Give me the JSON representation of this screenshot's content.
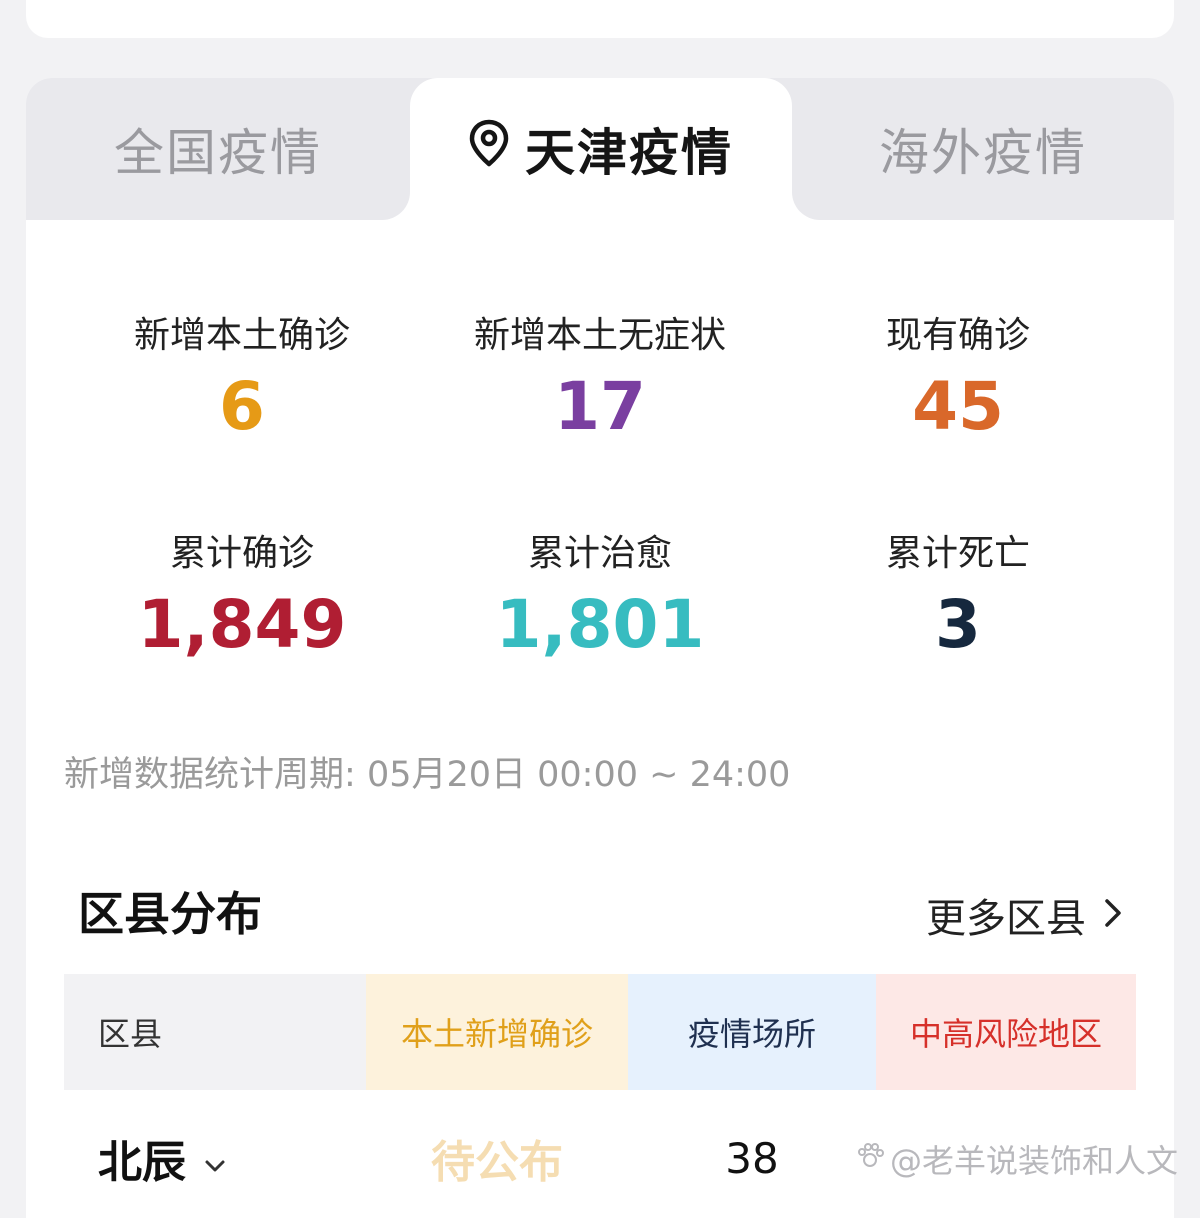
{
  "tabs": [
    {
      "label": "全国疫情",
      "active": false
    },
    {
      "label": "天津疫情",
      "active": true
    },
    {
      "label": "海外疫情",
      "active": false
    }
  ],
  "stats": [
    {
      "label": "新增本土确诊",
      "value": "6",
      "color": "#e69a16"
    },
    {
      "label": "新增本土无症状",
      "value": "17",
      "color": "#7a3fa0"
    },
    {
      "label": "现有确诊",
      "value": "45",
      "color": "#d9682a"
    },
    {
      "label": "累计确诊",
      "value": "1,849",
      "color": "#b01e33"
    },
    {
      "label": "累计治愈",
      "value": "1,801",
      "color": "#37bcc0"
    },
    {
      "label": "累计死亡",
      "value": "3",
      "color": "#16283e"
    }
  ],
  "period": {
    "label": "新增数据统计周期:",
    "range": "05月20日 00:00 ~ 24:00"
  },
  "district_section": {
    "title": "区县分布",
    "more": "更多区县"
  },
  "table": {
    "headers": [
      "区县",
      "本土新增确诊",
      "疫情场所",
      "中高风险地区"
    ],
    "rows": [
      {
        "district": "北辰",
        "new_confirmed": "待公布",
        "places": "38",
        "risk": ""
      }
    ]
  },
  "watermark": "@老羊说装饰和人文",
  "icons": {
    "tab_pin": "location-pin-icon",
    "more": "chevron-right-icon",
    "district_dropdown": "chevron-down-icon"
  }
}
